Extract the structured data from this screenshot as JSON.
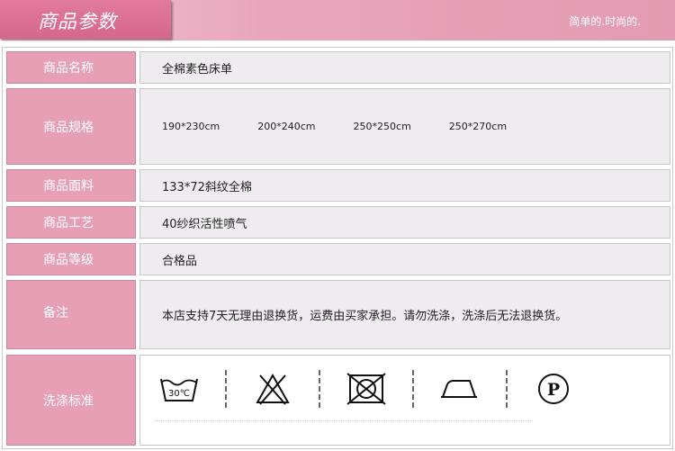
{
  "header": {
    "title": "商品参数",
    "slogan": "简单的.时尚的."
  },
  "rows": {
    "name": {
      "label": "商品名称",
      "value": "全棉素色床单"
    },
    "specs": {
      "label": "商品规格",
      "values": [
        "190*230cm",
        "200*240cm",
        "250*250cm",
        "250*270cm"
      ]
    },
    "fabric": {
      "label": "商品面料",
      "value": "133*72斜纹全棉"
    },
    "craft": {
      "label": "商品工艺",
      "value": "40纱织活性喷气"
    },
    "grade": {
      "label": "商品等级",
      "value": "合格品"
    },
    "notes": {
      "label": "备注",
      "value": "本店支持7天无理由退换货，运费由买家承担。请勿洗涤，洗涤后无法退换货。"
    },
    "wash": {
      "label": "洗涤标准",
      "icons": [
        "wash-30-icon",
        "no-bleach-icon",
        "no-tumble-dry-icon",
        "iron-icon",
        "dry-clean-p-icon"
      ],
      "wash_temp": "30℃",
      "dry_clean_letter": "P"
    }
  },
  "colors": {
    "header_tab": "#d5678c",
    "header_bar": "#e8a5bb",
    "label_bg": "#e79fb5",
    "value_bg": "#eeecee"
  }
}
